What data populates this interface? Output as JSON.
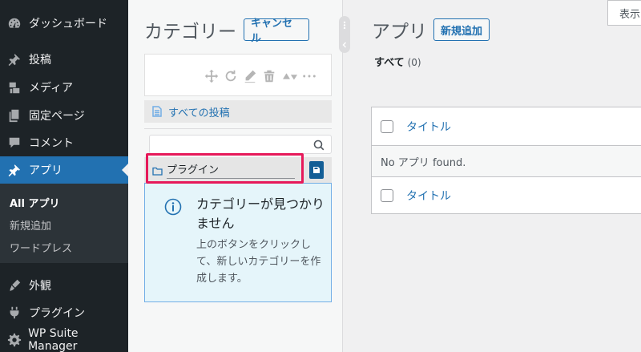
{
  "sidebar": {
    "items": [
      {
        "label": "ダッシュボード",
        "icon": "dashboard-icon"
      },
      {
        "label": "投稿",
        "icon": "pin-icon"
      },
      {
        "label": "メディア",
        "icon": "media-icon"
      },
      {
        "label": "固定ページ",
        "icon": "page-icon"
      },
      {
        "label": "コメント",
        "icon": "comment-icon"
      },
      {
        "label": "アプリ",
        "icon": "pin-icon",
        "active": true
      },
      {
        "label": "外観",
        "icon": "brush-icon"
      },
      {
        "label": "プラグイン",
        "icon": "plugin-icon"
      },
      {
        "label": "WP Suite Manager",
        "icon": "gear-icon"
      }
    ],
    "submenu": [
      {
        "label": "All アプリ",
        "current": true
      },
      {
        "label": "新規追加"
      },
      {
        "label": "ワードプレス"
      }
    ]
  },
  "category_panel": {
    "title": "カテゴリー",
    "cancel_label": "キャンセル",
    "all_posts_label": "すべての投稿",
    "search_placeholder": "",
    "new_category_value": "プラグイン",
    "notice_title": "カテゴリーが見つかりません",
    "notice_text": "上のボタンをクリックして、新しいカテゴリーを作成します。"
  },
  "main": {
    "title": "アプリ",
    "add_new_label": "新規追加",
    "display_label": "表示",
    "filter_all_label": "すべて",
    "filter_all_count": "(0)",
    "column_title": "タイトル",
    "empty_message": "No アプリ found."
  },
  "colors": {
    "sidebar_bg": "#1d2327",
    "accent": "#2271b1",
    "highlight": "#e6195a",
    "notice_bg": "#e5f5fa"
  }
}
